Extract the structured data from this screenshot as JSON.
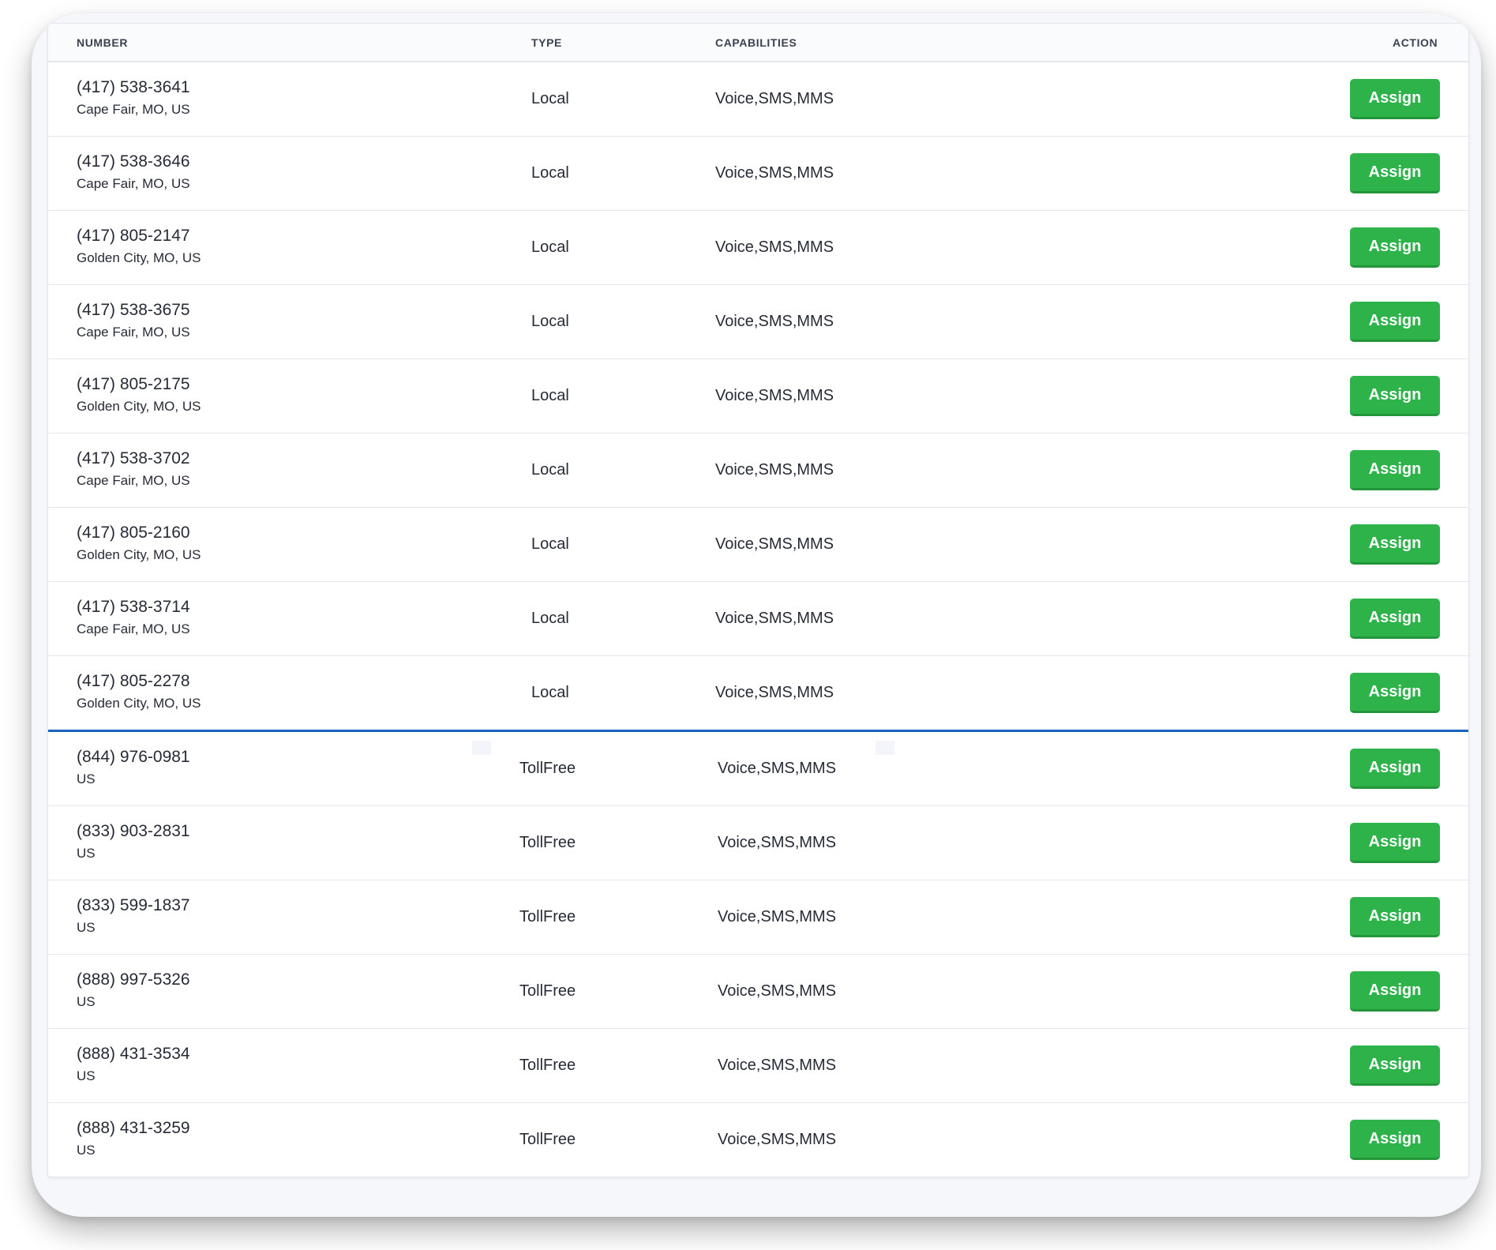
{
  "table": {
    "headers": {
      "number": "NUMBER",
      "type": "TYPE",
      "capabilities": "CAPABILITIES",
      "action": "ACTION"
    },
    "local_rows": [
      {
        "number": "(417) 538-3641",
        "location": "Cape Fair, MO, US",
        "type": "Local",
        "capabilities": "Voice,SMS,MMS",
        "action": "Assign"
      },
      {
        "number": "(417) 538-3646",
        "location": "Cape Fair, MO, US",
        "type": "Local",
        "capabilities": "Voice,SMS,MMS",
        "action": "Assign"
      },
      {
        "number": "(417) 805-2147",
        "location": "Golden City, MO, US",
        "type": "Local",
        "capabilities": "Voice,SMS,MMS",
        "action": "Assign"
      },
      {
        "number": "(417) 538-3675",
        "location": "Cape Fair, MO, US",
        "type": "Local",
        "capabilities": "Voice,SMS,MMS",
        "action": "Assign"
      },
      {
        "number": "(417) 805-2175",
        "location": "Golden City, MO, US",
        "type": "Local",
        "capabilities": "Voice,SMS,MMS",
        "action": "Assign"
      },
      {
        "number": "(417) 538-3702",
        "location": "Cape Fair, MO, US",
        "type": "Local",
        "capabilities": "Voice,SMS,MMS",
        "action": "Assign"
      },
      {
        "number": "(417) 805-2160",
        "location": "Golden City, MO, US",
        "type": "Local",
        "capabilities": "Voice,SMS,MMS",
        "action": "Assign"
      },
      {
        "number": "(417) 538-3714",
        "location": "Cape Fair, MO, US",
        "type": "Local",
        "capabilities": "Voice,SMS,MMS",
        "action": "Assign"
      },
      {
        "number": "(417) 805-2278",
        "location": "Golden City, MO, US",
        "type": "Local",
        "capabilities": "Voice,SMS,MMS",
        "action": "Assign"
      }
    ],
    "tollfree_rows": [
      {
        "number": "(844) 976-0981",
        "location": "US",
        "type": "TollFree",
        "capabilities": "Voice,SMS,MMS",
        "action": "Assign"
      },
      {
        "number": "(833) 903-2831",
        "location": "US",
        "type": "TollFree",
        "capabilities": "Voice,SMS,MMS",
        "action": "Assign"
      },
      {
        "number": "(833) 599-1837",
        "location": "US",
        "type": "TollFree",
        "capabilities": "Voice,SMS,MMS",
        "action": "Assign"
      },
      {
        "number": "(888) 997-5326",
        "location": "US",
        "type": "TollFree",
        "capabilities": "Voice,SMS,MMS",
        "action": "Assign"
      },
      {
        "number": "(888) 431-3534",
        "location": "US",
        "type": "TollFree",
        "capabilities": "Voice,SMS,MMS",
        "action": "Assign"
      },
      {
        "number": "(888) 431-3259",
        "location": "US",
        "type": "TollFree",
        "capabilities": "Voice,SMS,MMS",
        "action": "Assign"
      }
    ]
  },
  "colors": {
    "assign_button": "#2db34a",
    "section_divider": "#1565c0"
  }
}
